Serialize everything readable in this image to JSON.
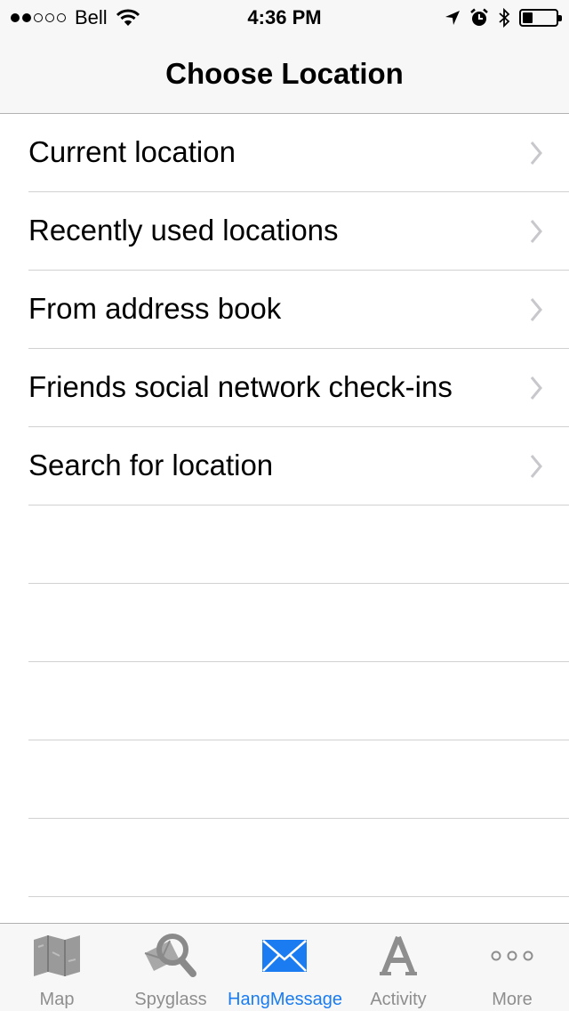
{
  "status_bar": {
    "signal_filled": 2,
    "signal_total": 5,
    "carrier": "Bell",
    "time": "4:36 PM",
    "battery_level": 0.3
  },
  "nav": {
    "title": "Choose Location"
  },
  "list": {
    "items": [
      {
        "label": "Current location"
      },
      {
        "label": "Recently used locations"
      },
      {
        "label": "From address book"
      },
      {
        "label": "Friends social network check-ins"
      },
      {
        "label": "Search for location"
      }
    ],
    "empty_rows": 5
  },
  "tab_bar": {
    "active_index": 2,
    "active_color": "#1a7cf0",
    "inactive_color": "#8e8e8e",
    "tabs": [
      {
        "label": "Map",
        "icon": "map-icon"
      },
      {
        "label": "Spyglass",
        "icon": "spyglass-icon"
      },
      {
        "label": "HangMessage",
        "icon": "envelope-icon"
      },
      {
        "label": "Activity",
        "icon": "activity-icon"
      },
      {
        "label": "More",
        "icon": "more-icon"
      }
    ]
  }
}
